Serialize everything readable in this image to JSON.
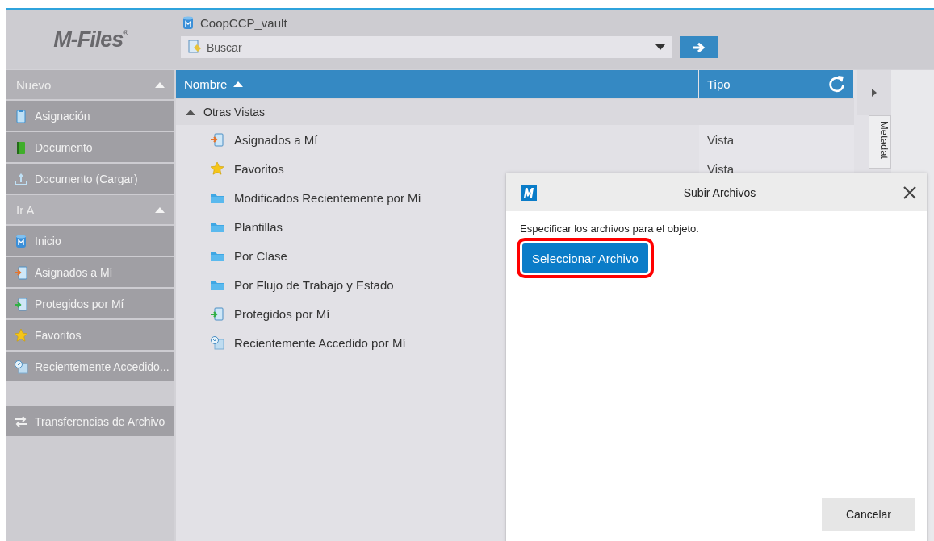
{
  "logo": "M-Files$^{®}$",
  "vault": {
    "name": "CoopCCP_vault"
  },
  "search": {
    "placeholder": "Buscar"
  },
  "sidebar": {
    "sections": [
      {
        "title": "Nuevo",
        "expanded": true,
        "items": [
          {
            "label": "Asignación",
            "kind": "assignment"
          },
          {
            "label": "Documento",
            "kind": "document"
          },
          {
            "label": "Documento (Cargar)",
            "kind": "upload"
          }
        ]
      },
      {
        "title": "Ir A",
        "expanded": true,
        "items": [
          {
            "label": "Inicio",
            "kind": "vault"
          },
          {
            "label": "Asignados a Mí",
            "kind": "assigned"
          },
          {
            "label": "Protegidos por Mí",
            "kind": "checked-out"
          },
          {
            "label": "Favoritos",
            "kind": "favorite"
          },
          {
            "label": "Recientemente Accedido...",
            "kind": "recent"
          }
        ]
      }
    ],
    "footer": [
      {
        "label": "Transferencias de Archivo",
        "kind": "transfer"
      }
    ]
  },
  "table": {
    "columns": [
      {
        "label": "Nombre",
        "sorted": true
      },
      {
        "label": "Tipo",
        "sorted": false
      }
    ],
    "group": {
      "label": "Otras Vistas",
      "expanded": true
    },
    "rows": [
      {
        "name": "Asignados a Mí",
        "kind": "assigned",
        "type": "Vista"
      },
      {
        "name": "Favoritos",
        "kind": "favorite",
        "type": "Vista"
      },
      {
        "name": "Modificados Recientemente por Mí",
        "kind": "folder"
      },
      {
        "name": "Plantillas",
        "kind": "folder"
      },
      {
        "name": "Por Clase",
        "kind": "folder"
      },
      {
        "name": "Por Flujo de Trabajo y Estado",
        "kind": "folder"
      },
      {
        "name": "Protegidos por Mí",
        "kind": "checked-out"
      },
      {
        "name": "Recientemente Accedido por Mí",
        "kind": "recent"
      }
    ]
  },
  "right_panel": {
    "tab": "Metadat"
  },
  "dialog": {
    "title": "Subir Archivos",
    "message": "Especificar los archivos para el objeto.",
    "select_button": {
      "label": "Seleccionar Archivo",
      "highlighted": true
    },
    "cancel_button": "Cancelar"
  }
}
